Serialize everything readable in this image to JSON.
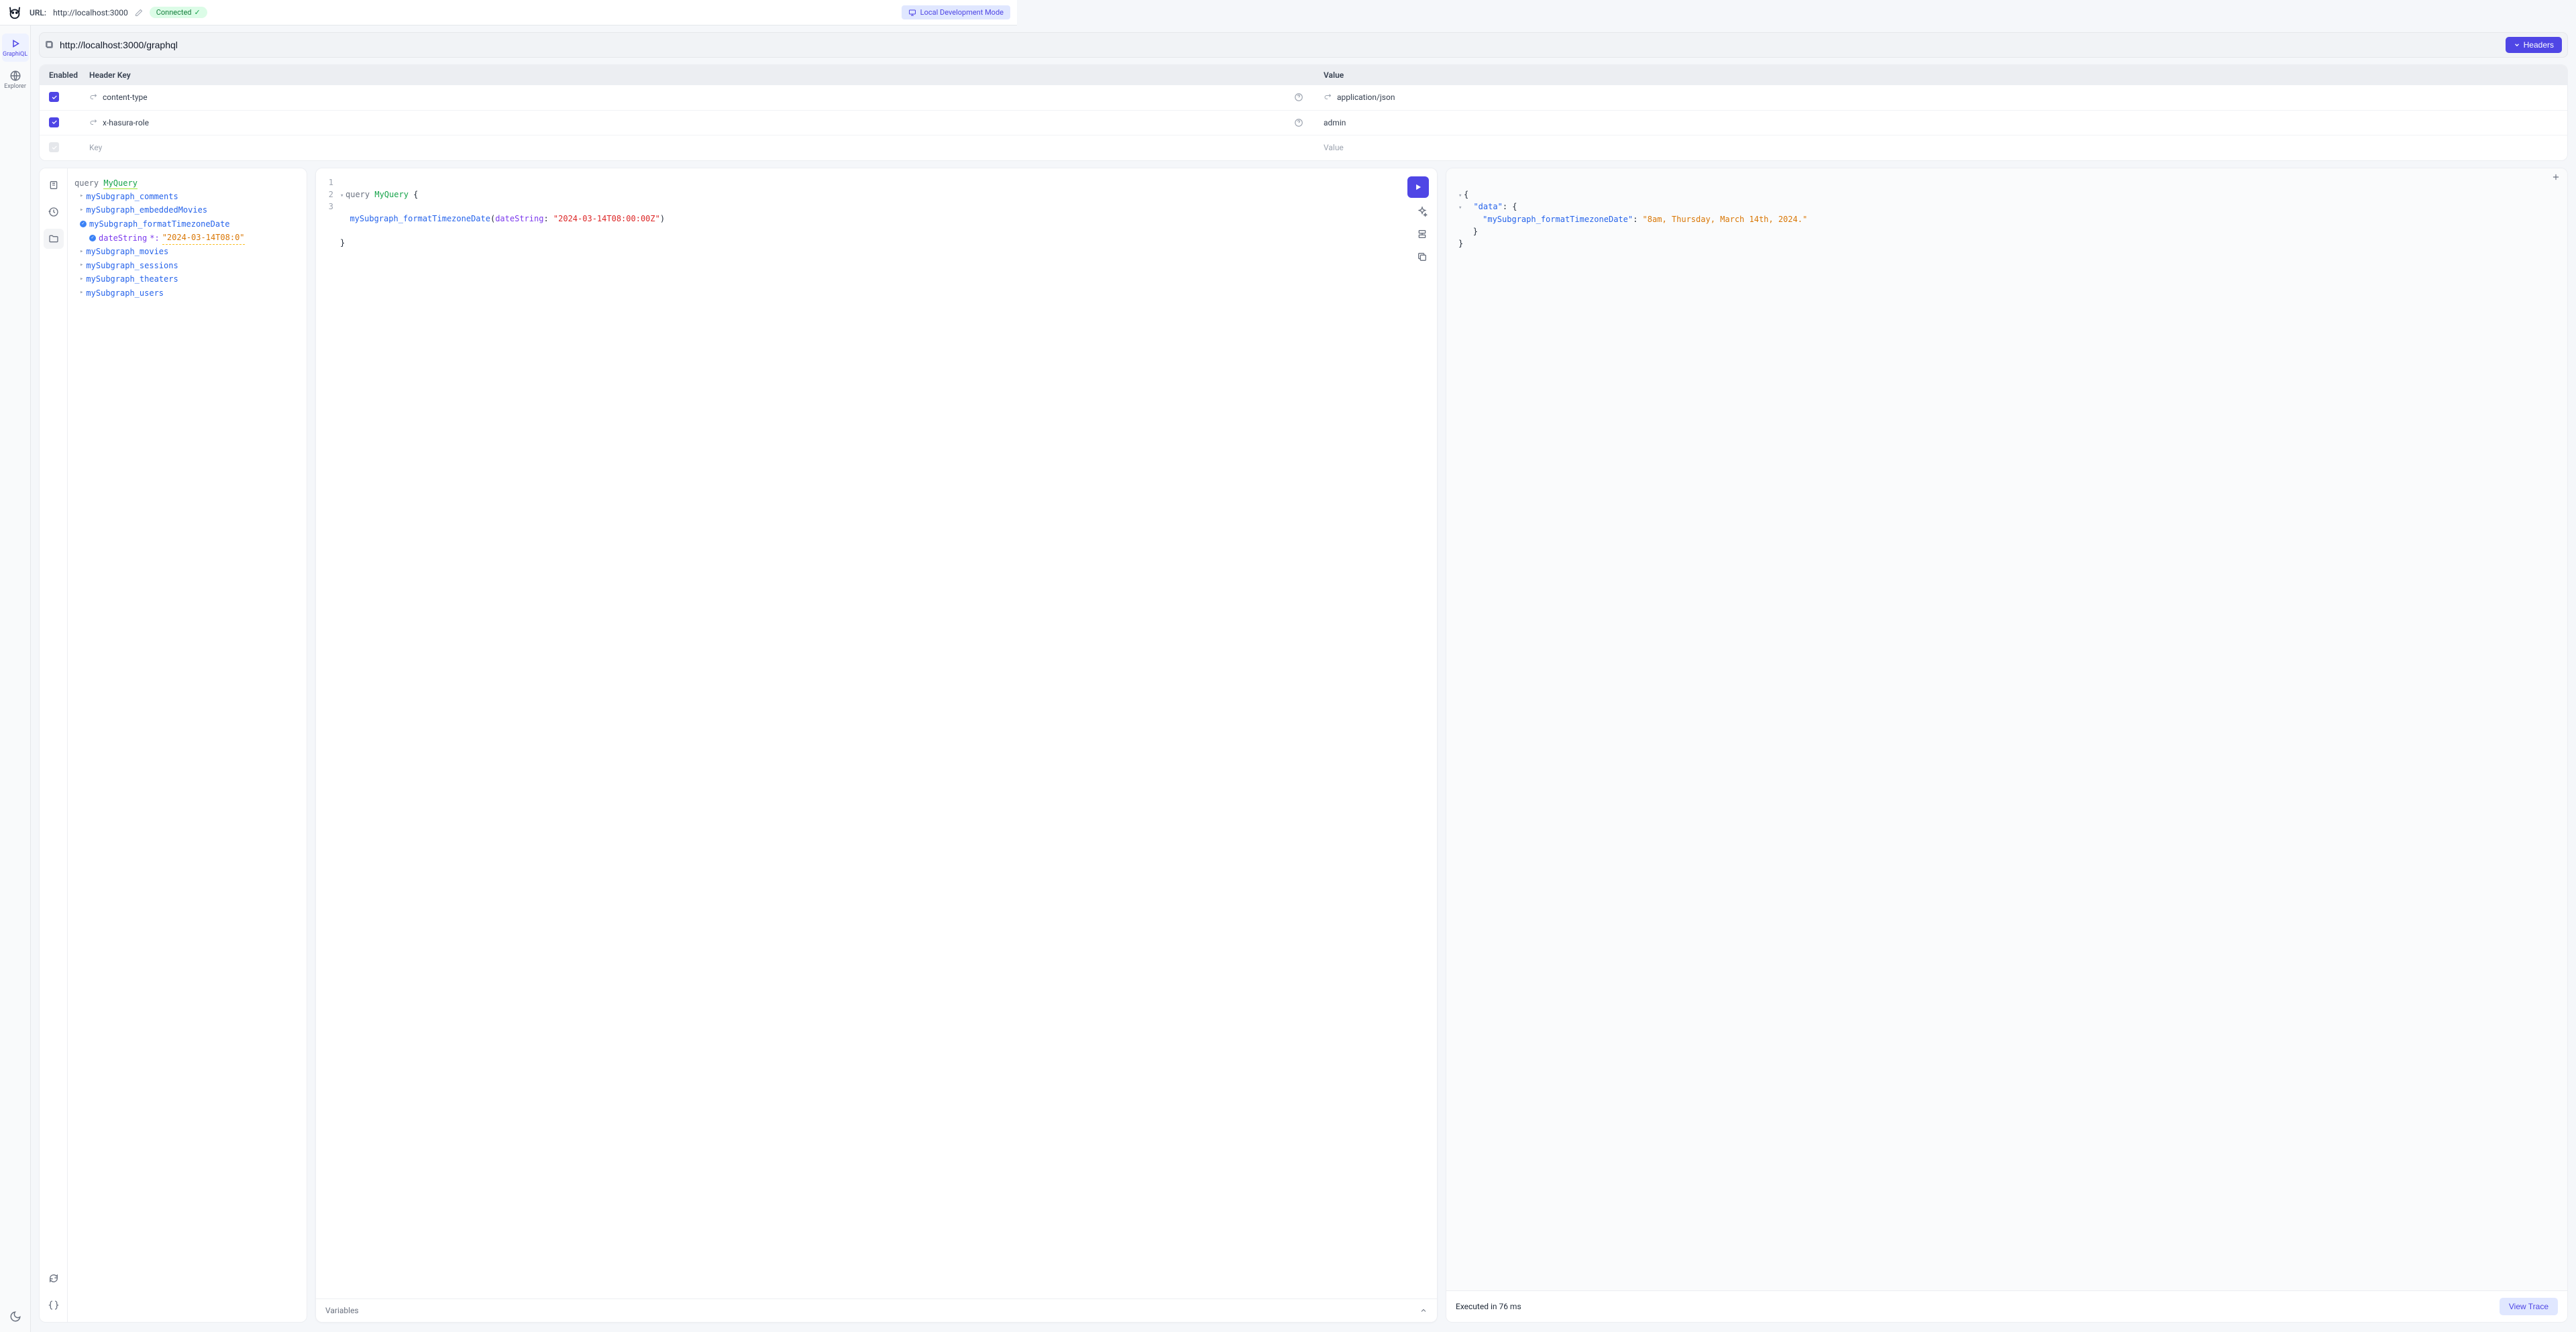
{
  "topbar": {
    "url_label": "URL:",
    "url_value": "http://localhost:3000",
    "status": "Connected",
    "dev_mode": "Local Development Mode"
  },
  "left_rail": {
    "graphiql": "GraphiQL",
    "explorer": "Explorer"
  },
  "urlbar": {
    "value": "http://localhost:3000/graphql",
    "headers_btn": "Headers"
  },
  "headers_table": {
    "cols": {
      "enabled": "Enabled",
      "key": "Header Key",
      "value": "Value"
    },
    "rows": [
      {
        "enabled": true,
        "locked": true,
        "key": "content-type",
        "help": true,
        "locked_val": true,
        "value": "application/json"
      },
      {
        "enabled": true,
        "locked": true,
        "key": "x-hasura-role",
        "help": true,
        "locked_val": false,
        "value": "admin"
      }
    ],
    "empty": {
      "key_ph": "Key",
      "val_ph": "Value"
    }
  },
  "explorer": {
    "query_kw": "query",
    "query_name": "MyQuery",
    "fields": [
      {
        "name": "mySubgraph_comments",
        "checked": false
      },
      {
        "name": "mySubgraph_embeddedMovies",
        "checked": false
      },
      {
        "name": "mySubgraph_formatTimezoneDate",
        "checked": true,
        "arg": {
          "name": "dateString",
          "required": true,
          "value": "\"2024-03-14T08:0\""
        }
      },
      {
        "name": "mySubgraph_movies",
        "checked": false
      },
      {
        "name": "mySubgraph_sessions",
        "checked": false
      },
      {
        "name": "mySubgraph_theaters",
        "checked": false
      },
      {
        "name": "mySubgraph_users",
        "checked": false
      }
    ]
  },
  "editor": {
    "lines": [
      "1",
      "2",
      "3"
    ],
    "code": {
      "l1_kw": "query",
      "l1_name": "MyQuery",
      "l1_brace": " {",
      "l2_func": "mySubgraph_formatTimezoneDate",
      "l2_open": "(",
      "l2_arg": "dateString",
      "l2_colon": ": ",
      "l2_str": "\"2024-03-14T08:00:00Z\"",
      "l2_close": ")",
      "l3": "}"
    },
    "variables_label": "Variables"
  },
  "result": {
    "json": {
      "open": "{",
      "data_key": "\"data\"",
      "data_colon": ": {",
      "field_key": "\"mySubgraph_formatTimezoneDate\"",
      "field_colon": ": ",
      "field_val": "\"8am, Thursday, March 14th, 2024.\"",
      "inner_close": "}",
      "outer_close": "}"
    },
    "footer_text": "Executed in 76 ms",
    "trace_btn": "View Trace"
  }
}
